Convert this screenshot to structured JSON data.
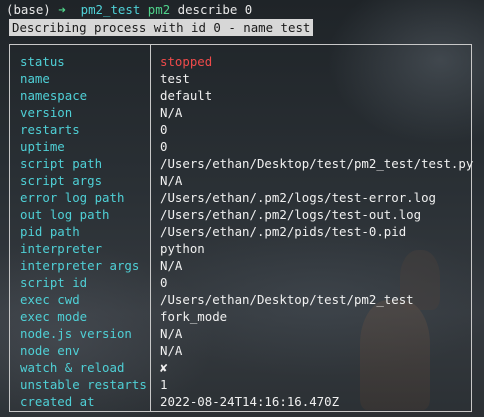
{
  "terminal": {
    "prompt": {
      "env": "(base)",
      "arrow": "➜",
      "dir": "pm2_test",
      "cmd": "pm2",
      "args": "describe 0"
    },
    "banner": "Describing process with id 0 - name test",
    "rows": [
      {
        "key": "status",
        "value": "stopped"
      },
      {
        "key": "name",
        "value": "test"
      },
      {
        "key": "namespace",
        "value": "default"
      },
      {
        "key": "version",
        "value": "N/A"
      },
      {
        "key": "restarts",
        "value": "0"
      },
      {
        "key": "uptime",
        "value": "0"
      },
      {
        "key": "script path",
        "value": "/Users/ethan/Desktop/test/pm2_test/test.py"
      },
      {
        "key": "script args",
        "value": "N/A"
      },
      {
        "key": "error log path",
        "value": "/Users/ethan/.pm2/logs/test-error.log"
      },
      {
        "key": "out log path",
        "value": "/Users/ethan/.pm2/logs/test-out.log"
      },
      {
        "key": "pid path",
        "value": "/Users/ethan/.pm2/pids/test-0.pid"
      },
      {
        "key": "interpreter",
        "value": "python"
      },
      {
        "key": "interpreter args",
        "value": "N/A"
      },
      {
        "key": "script id",
        "value": "0"
      },
      {
        "key": "exec cwd",
        "value": "/Users/ethan/Desktop/test/pm2_test"
      },
      {
        "key": "exec mode",
        "value": "fork_mode"
      },
      {
        "key": "node.js version",
        "value": "N/A"
      },
      {
        "key": "node env",
        "value": "N/A"
      },
      {
        "key": "watch & reload",
        "value": "✘"
      },
      {
        "key": "unstable restarts",
        "value": "1"
      },
      {
        "key": "created at",
        "value": "2022-08-24T14:16:16.470Z"
      }
    ]
  },
  "colors": {
    "key": "#4fd0d6",
    "value": "#f0f0f0",
    "status_stopped": "#ef4a4a",
    "prompt_arrow": "#4fd28a",
    "prompt_dir": "#4fd0d6",
    "banner_bg": "#d7d7d7"
  }
}
